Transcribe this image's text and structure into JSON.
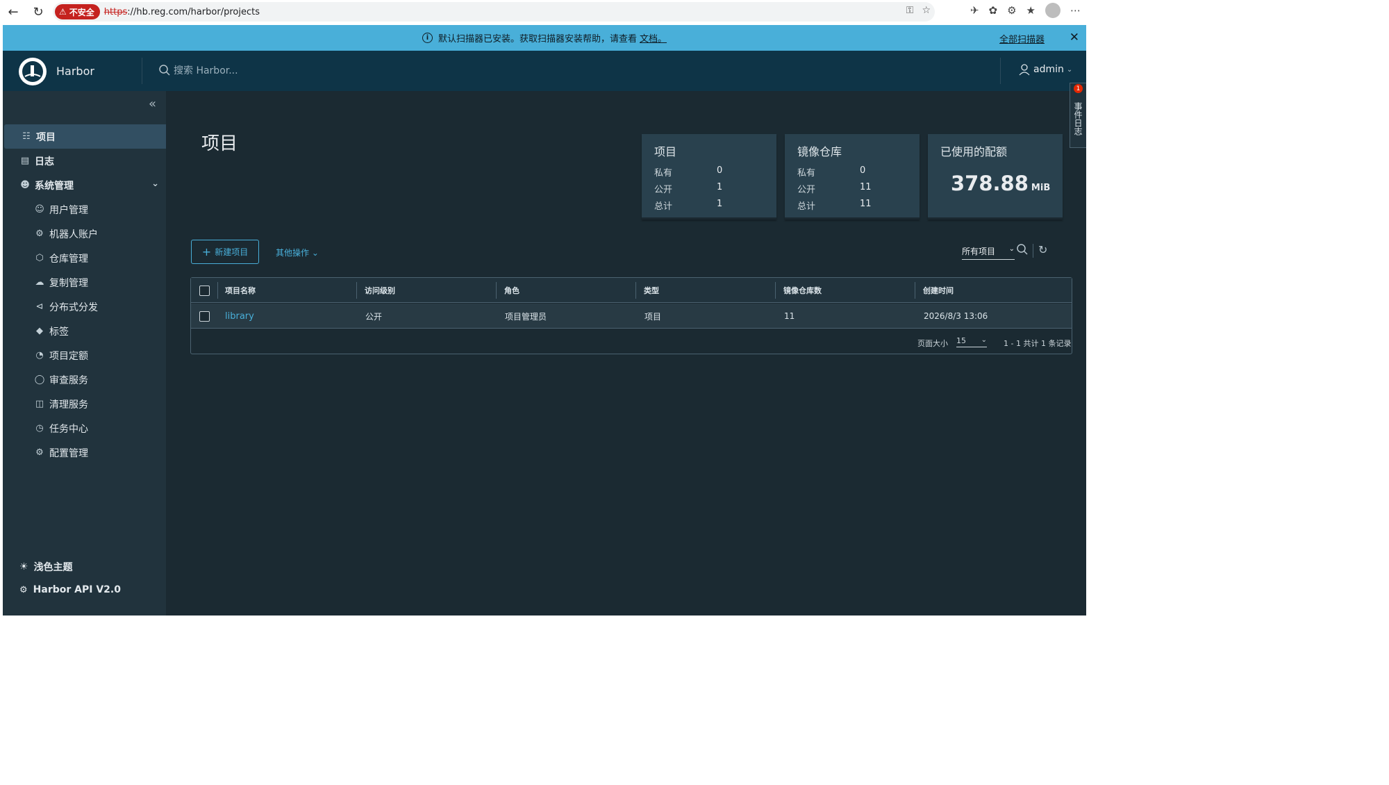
{
  "browser": {
    "insecure_label": "不安全",
    "url_scheme": "https",
    "url_rest": "://hb.reg.com/harbor/projects"
  },
  "banner": {
    "message": "默认扫描器已安装。获取扫描器安装帮助，请查看",
    "doc_link": "文档。",
    "all_scanners": "全部扫描器"
  },
  "header": {
    "brand": "Harbor",
    "search_placeholder": "搜索 Harbor...",
    "user": "admin"
  },
  "event_log": {
    "label": "事件日志",
    "count": "1"
  },
  "sidebar": {
    "items": [
      {
        "label": "项目",
        "icon": "projects-icon"
      },
      {
        "label": "日志",
        "icon": "logs-icon"
      },
      {
        "label": "系统管理",
        "icon": "admin-icon"
      }
    ],
    "sub_items": [
      {
        "label": "用户管理",
        "icon": "users-icon"
      },
      {
        "label": "机器人账户",
        "icon": "robot-icon"
      },
      {
        "label": "仓库管理",
        "icon": "registry-icon"
      },
      {
        "label": "复制管理",
        "icon": "replication-icon"
      },
      {
        "label": "分布式分发",
        "icon": "share-icon"
      },
      {
        "label": "标签",
        "icon": "tag-icon"
      },
      {
        "label": "项目定额",
        "icon": "quota-icon"
      },
      {
        "label": "审查服务",
        "icon": "shield-icon"
      },
      {
        "label": "清理服务",
        "icon": "trash-icon"
      },
      {
        "label": "任务中心",
        "icon": "dashboard-icon"
      },
      {
        "label": "配置管理",
        "icon": "gear-icon"
      }
    ],
    "theme": "浅色主题",
    "api": "Harbor API V2.0"
  },
  "page": {
    "title": "项目"
  },
  "cards": {
    "projects": {
      "title": "项目",
      "private_label": "私有",
      "private": "0",
      "public_label": "公开",
      "public": "1",
      "total_label": "总计",
      "total": "1"
    },
    "repos": {
      "title": "镜像仓库",
      "private_label": "私有",
      "private": "0",
      "public_label": "公开",
      "public": "11",
      "total_label": "总计",
      "total": "11"
    },
    "quota": {
      "title": "已使用的配额",
      "value": "378.88",
      "unit": "MiB"
    }
  },
  "toolbar": {
    "new_project": "新建项目",
    "other_actions": "其他操作",
    "filter": "所有项目"
  },
  "table": {
    "columns": [
      "项目名称",
      "访问级别",
      "角色",
      "类型",
      "镜像仓库数",
      "创建时间"
    ],
    "rows": [
      {
        "name": "library",
        "access": "公开",
        "role": "项目管理员",
        "type": "项目",
        "repo_count": "11",
        "created": "2026/8/3 13:06"
      }
    ],
    "page_size_label": "页面大小",
    "page_size": "15",
    "range": "1 - 1 共计 1 条记录"
  },
  "colors": {
    "accent": "#49afd9",
    "banner": "#49afd9",
    "header": "#0e3447",
    "sidebar": "#21333d",
    "content": "#1b2a32"
  }
}
